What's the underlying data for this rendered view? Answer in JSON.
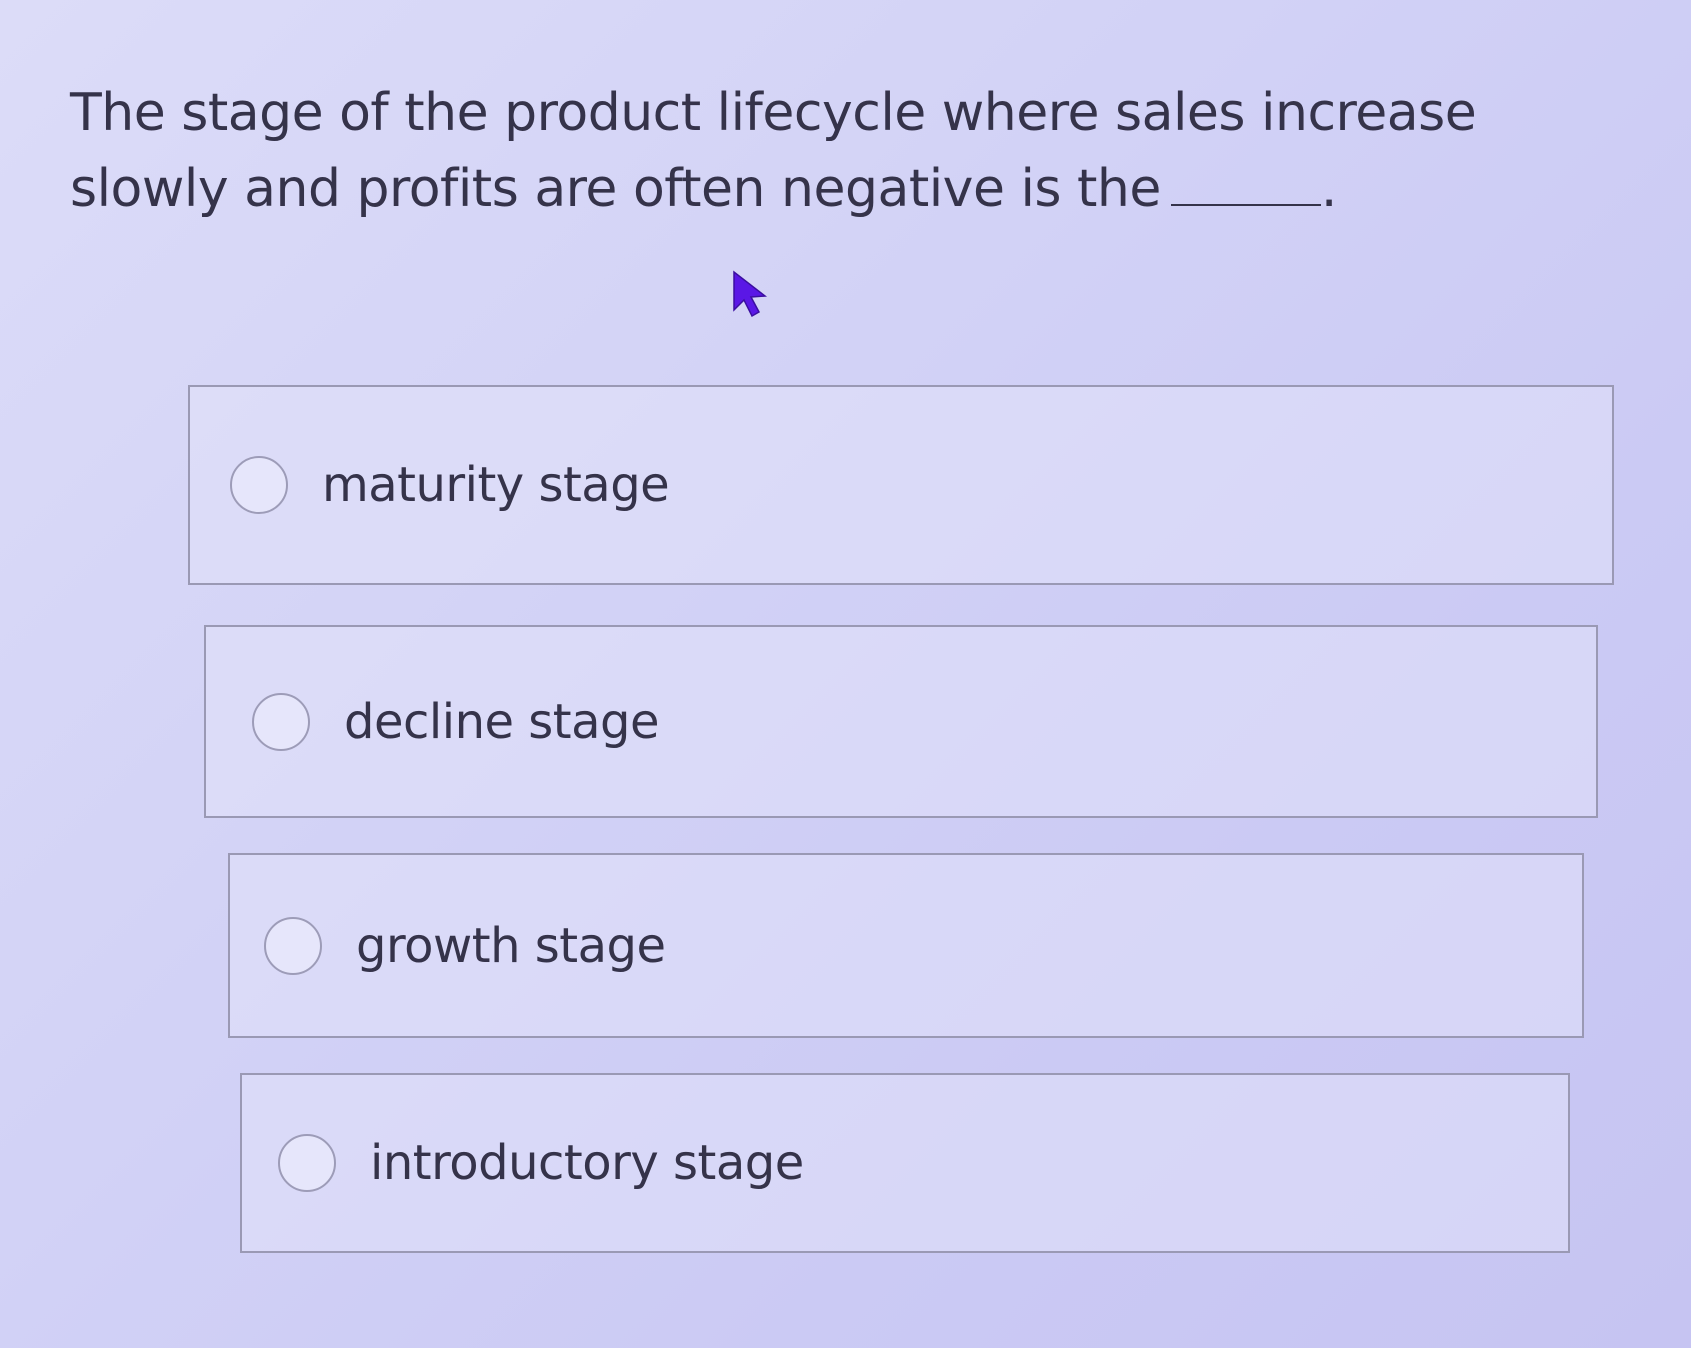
{
  "question": {
    "text_before_blank": "The stage of the product lifecycle where sales increase slowly and profits are often negative is the",
    "text_after_blank": "."
  },
  "options": [
    {
      "label": "maturity stage",
      "selected": false
    },
    {
      "label": "decline stage",
      "selected": false
    },
    {
      "label": "growth stage",
      "selected": false
    },
    {
      "label": "introductory stage",
      "selected": false
    }
  ],
  "icons": {
    "cursor": "mouse-pointer-icon",
    "radio": "radio-unselected-icon"
  },
  "colors": {
    "background": "#d2d2f6",
    "text": "#35334a",
    "border": "#9a99b4",
    "cursor": "#5a17e6"
  }
}
